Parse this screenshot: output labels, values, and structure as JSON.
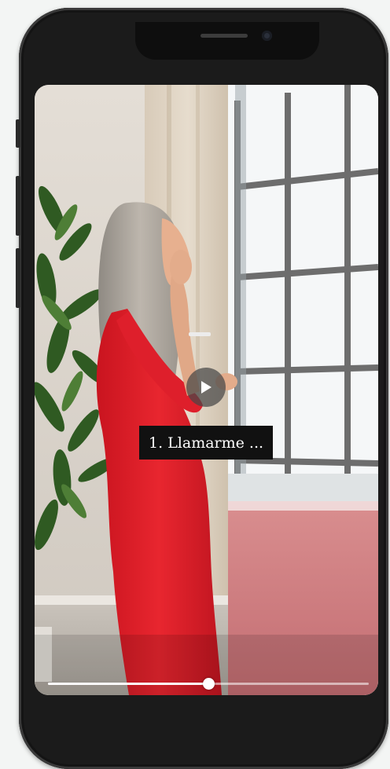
{
  "video": {
    "caption": "1. Llamarme ...",
    "progress": 0.5,
    "state": "paused"
  },
  "icons": {
    "play": "play-icon"
  },
  "colors": {
    "dress": "#e0202c",
    "phone_body": "#1b1b1b",
    "caption_bg": "#111111"
  }
}
